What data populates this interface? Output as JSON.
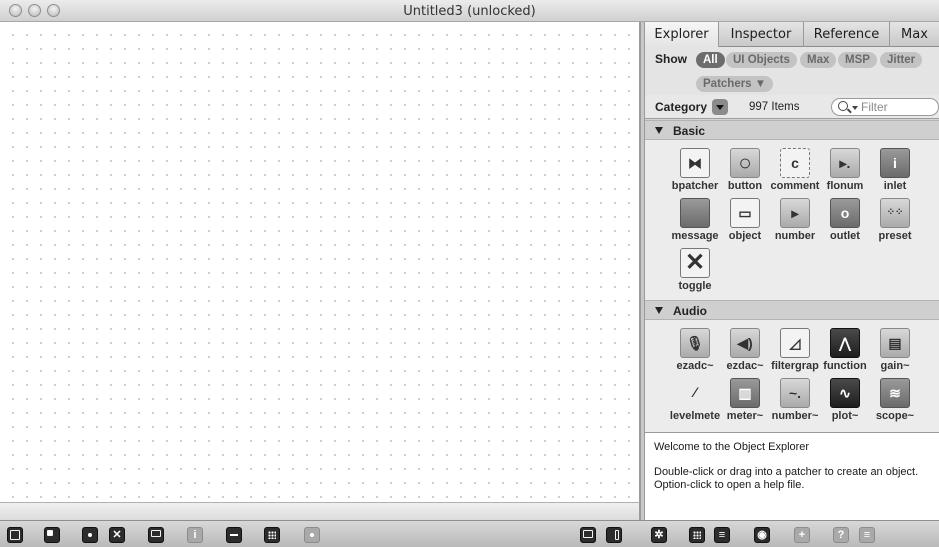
{
  "window": {
    "title": "Untitled3 (unlocked)"
  },
  "explorer": {
    "tabs": [
      "Explorer",
      "Inspector",
      "Reference",
      "Max"
    ],
    "show_label": "Show",
    "filters": [
      "All",
      "UI Objects",
      "Max",
      "MSP",
      "Jitter",
      "Patchers ▼"
    ],
    "active_filter": "All",
    "category_label": "Category",
    "item_count": "997 Items",
    "filter_placeholder": "Filter",
    "sections": [
      {
        "title": "Basic",
        "items": [
          "bpatcher",
          "button",
          "comment",
          "flonum",
          "inlet",
          "message",
          "object",
          "number",
          "outlet",
          "preset",
          "toggle"
        ]
      },
      {
        "title": "Audio",
        "items": [
          "ezadc~",
          "ezdac~",
          "filtergrap",
          "function",
          "gain~",
          "levelmete",
          "meter~",
          "number~",
          "plot~",
          "scope~"
        ]
      }
    ],
    "info": {
      "heading": "Welcome to the Object Explorer",
      "line1": "Double-click or drag into a patcher to create an object.",
      "line2": "Option-click to open a help file."
    }
  },
  "toolbar": {
    "left_icons": [
      "new-object-icon",
      "new-patcher-icon",
      "palette-icon",
      "object-box-icon",
      "presentation-icon",
      "inspector-icon",
      "connect-icon",
      "grid-icon",
      "snap-icon"
    ],
    "right_icons": [
      "single-pane-icon",
      "split-pane-icon"
    ],
    "panel_icons": [
      "gear-icon",
      "grid-view-icon",
      "list-view-icon",
      "eye-icon",
      "add-icon",
      "help-icon",
      "menu-icon"
    ]
  }
}
